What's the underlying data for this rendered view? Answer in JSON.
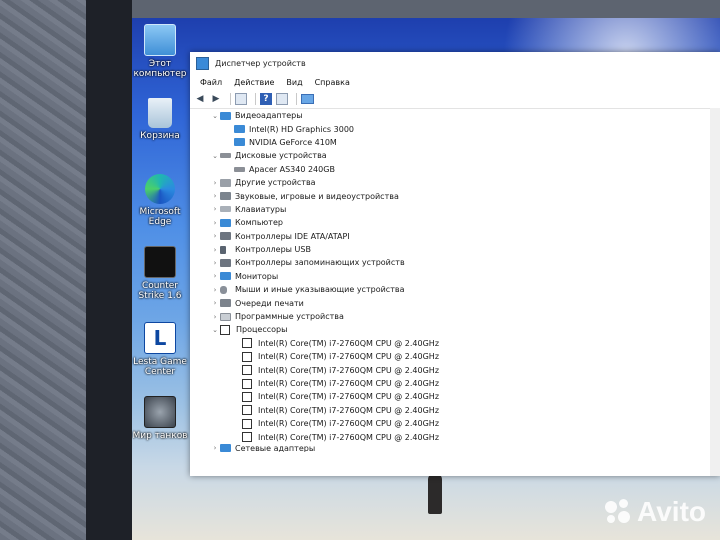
{
  "window": {
    "title": "Диспетчер устройств",
    "menu": [
      "Файл",
      "Действие",
      "Вид",
      "Справка"
    ]
  },
  "desktop_icons": [
    {
      "label": "Этот компьютер",
      "icon": "computer-icon"
    },
    {
      "label": "Корзина",
      "icon": "recycle-bin-icon"
    },
    {
      "label": "Microsoft Edge",
      "icon": "edge-icon"
    },
    {
      "label": "Counter Strike 1.6",
      "icon": "cs-icon"
    },
    {
      "label": "Lesta Game Center",
      "icon": "lesta-icon"
    },
    {
      "label": "Мир танков",
      "icon": "tanks-icon"
    }
  ],
  "tree": {
    "video": {
      "label": "Видеоадаптеры",
      "children": [
        "Intel(R) HD Graphics 3000",
        "NVIDIA GeForce 410M"
      ]
    },
    "disks": {
      "label": "Дисковые устройства",
      "children": [
        "Apacer AS340 240GB"
      ]
    },
    "collapsed": [
      "Другие устройства",
      "Звуковые, игровые и видеоустройства",
      "Клавиатуры",
      "Компьютер",
      "Контроллеры IDE ATA/ATAPI",
      "Контроллеры USB",
      "Контроллеры запоминающих устройств",
      "Мониторы",
      "Мыши и иные указывающие устройства",
      "Очереди печати",
      "Программные устройства"
    ],
    "cpu": {
      "label": "Процессоры",
      "children": [
        "Intel(R) Core(TM) i7-2760QM CPU @ 2.40GHz",
        "Intel(R) Core(TM) i7-2760QM CPU @ 2.40GHz",
        "Intel(R) Core(TM) i7-2760QM CPU @ 2.40GHz",
        "Intel(R) Core(TM) i7-2760QM CPU @ 2.40GHz",
        "Intel(R) Core(TM) i7-2760QM CPU @ 2.40GHz",
        "Intel(R) Core(TM) i7-2760QM CPU @ 2.40GHz",
        "Intel(R) Core(TM) i7-2760QM CPU @ 2.40GHz",
        "Intel(R) Core(TM) i7-2760QM CPU @ 2.40GHz"
      ]
    },
    "network": {
      "label": "Сетевые адаптеры"
    }
  },
  "watermark": "Avito"
}
